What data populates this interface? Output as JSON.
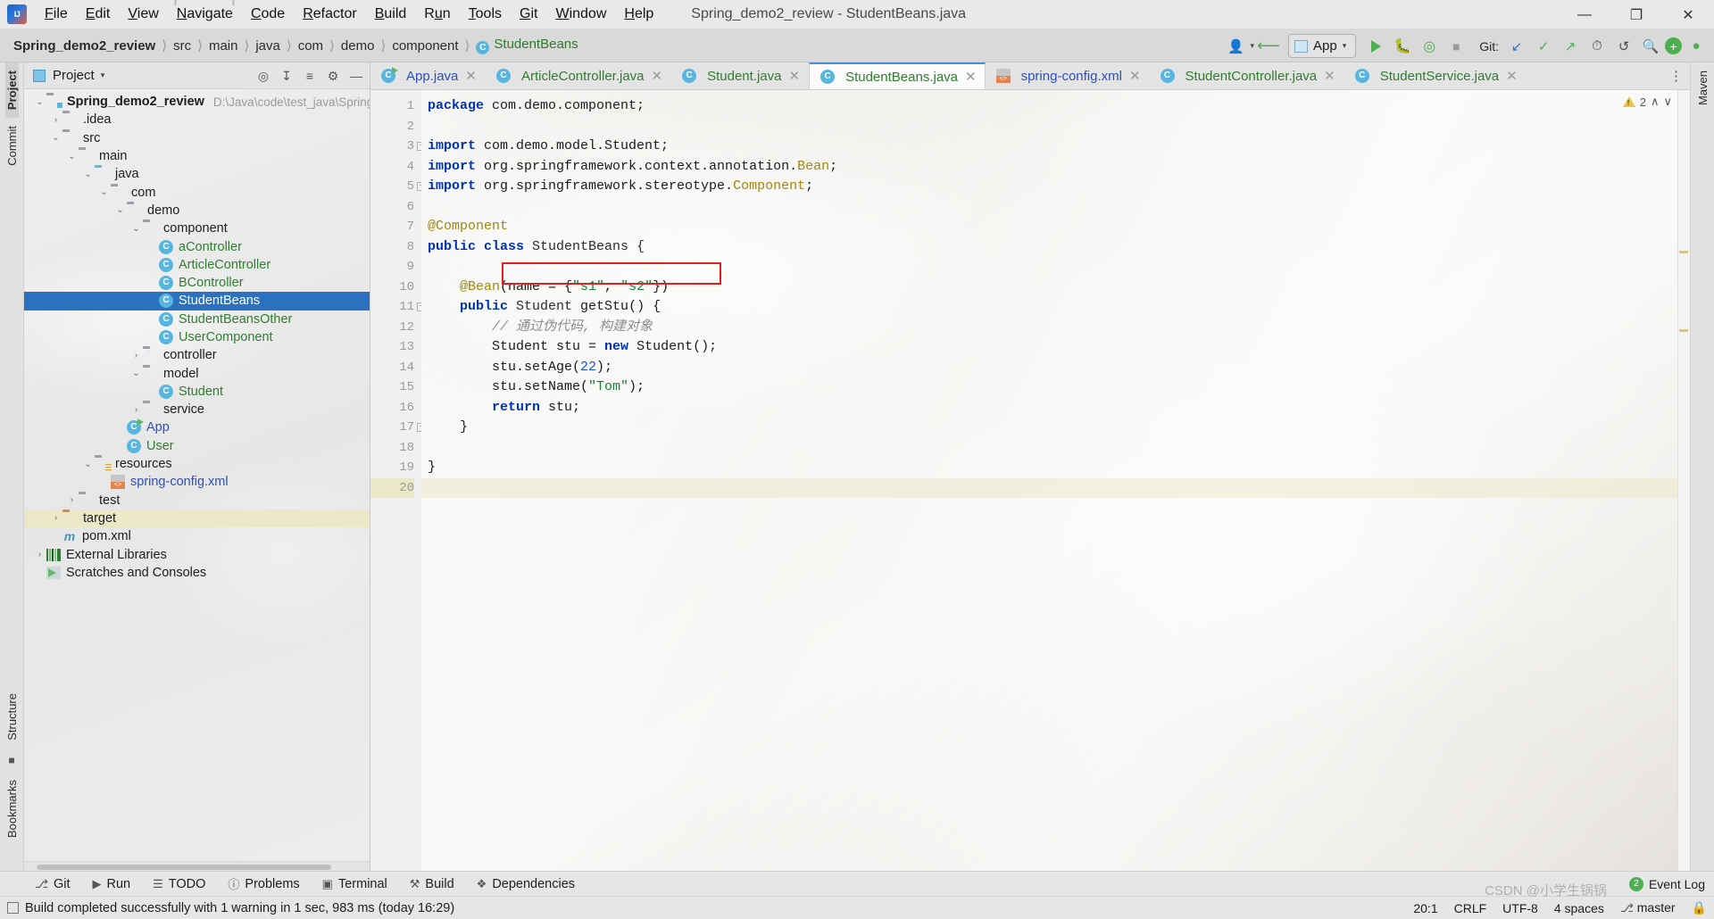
{
  "window": {
    "title": "Spring_demo2_review - StudentBeans.java",
    "minimize": "—",
    "maximize": "❐",
    "close": "✕"
  },
  "menu": {
    "items": [
      "File",
      "Edit",
      "View",
      "Navigate",
      "Code",
      "Refactor",
      "Build",
      "Run",
      "Tools",
      "Git",
      "Window",
      "Help"
    ],
    "highlighted": "Navigate"
  },
  "breadcrumb": {
    "items": [
      "Spring_demo2_review",
      "src",
      "main",
      "java",
      "com",
      "demo",
      "component",
      "StudentBeans"
    ],
    "separator": "〉",
    "class_badge": "C"
  },
  "toolbar": {
    "profile_icon": "user-icon",
    "build_icon": "hammer-icon",
    "run_config": "App",
    "run_label": "Run",
    "debug_label": "Debug",
    "coverage_label": "Run with Coverage",
    "stop_label": "Stop",
    "git_label": "Git:",
    "git_update": "↙",
    "git_commit": "✓",
    "git_push": "↗",
    "history": "◴",
    "undo": "↺",
    "search": "⚲",
    "plugin_update": "+",
    "caret": "▾"
  },
  "left_rail": {
    "project_tab": "Project",
    "commit_tab": "Commit",
    "structure_tab": "Structure",
    "bookmarks_tab": "Bookmarks"
  },
  "right_rail": {
    "maven_tab": "Maven"
  },
  "project_panel": {
    "header_title": "Project",
    "tool_icons": [
      "target-icon",
      "collapse-all-icon",
      "expand-icon",
      "settings-icon",
      "hide-icon"
    ],
    "tree": [
      {
        "depth": 0,
        "twist": "v",
        "icon": "folder-module",
        "label": "Spring_demo2_review",
        "style": "bold",
        "path": "D:\\Java\\code\\test_java\\Spring_dem"
      },
      {
        "depth": 1,
        "twist": ">",
        "icon": "folder",
        "label": ".idea",
        "style": ""
      },
      {
        "depth": 1,
        "twist": "v",
        "icon": "folder",
        "label": "src",
        "style": ""
      },
      {
        "depth": 2,
        "twist": "v",
        "icon": "folder",
        "label": "main",
        "style": ""
      },
      {
        "depth": 3,
        "twist": "v",
        "icon": "folder-source",
        "label": "java",
        "style": ""
      },
      {
        "depth": 4,
        "twist": "v",
        "icon": "folder-package",
        "label": "com",
        "style": ""
      },
      {
        "depth": 5,
        "twist": "v",
        "icon": "folder-package",
        "label": "demo",
        "style": ""
      },
      {
        "depth": 6,
        "twist": "v",
        "icon": "folder-package",
        "label": "component",
        "style": ""
      },
      {
        "depth": 7,
        "twist": "",
        "icon": "class",
        "label": "aController",
        "style": "green"
      },
      {
        "depth": 7,
        "twist": "",
        "icon": "class",
        "label": "ArticleController",
        "style": "green"
      },
      {
        "depth": 7,
        "twist": "",
        "icon": "class",
        "label": "BController",
        "style": "green"
      },
      {
        "depth": 7,
        "twist": "",
        "icon": "class",
        "label": "StudentBeans",
        "style": "selected"
      },
      {
        "depth": 7,
        "twist": "",
        "icon": "class",
        "label": "StudentBeansOther",
        "style": "green"
      },
      {
        "depth": 7,
        "twist": "",
        "icon": "class",
        "label": "UserComponent",
        "style": "green"
      },
      {
        "depth": 6,
        "twist": ">",
        "icon": "folder-package",
        "label": "controller",
        "style": ""
      },
      {
        "depth": 6,
        "twist": "v",
        "icon": "folder-package",
        "label": "model",
        "style": ""
      },
      {
        "depth": 7,
        "twist": "",
        "icon": "class",
        "label": "Student",
        "style": "green"
      },
      {
        "depth": 6,
        "twist": ">",
        "icon": "folder-package",
        "label": "service",
        "style": ""
      },
      {
        "depth": 5,
        "twist": "",
        "icon": "class-run",
        "label": "App",
        "style": "blue"
      },
      {
        "depth": 5,
        "twist": "",
        "icon": "class",
        "label": "User",
        "style": "green"
      },
      {
        "depth": 3,
        "twist": "v",
        "icon": "folder-resources",
        "label": "resources",
        "style": ""
      },
      {
        "depth": 4,
        "twist": "",
        "icon": "xml",
        "label": "spring-config.xml",
        "style": "blue"
      },
      {
        "depth": 2,
        "twist": ">",
        "icon": "folder",
        "label": "test",
        "style": ""
      },
      {
        "depth": 1,
        "twist": ">",
        "icon": "folder-excluded",
        "label": "target",
        "style": "highlight"
      },
      {
        "depth": 1,
        "twist": "",
        "icon": "maven",
        "label": "pom.xml",
        "style": ""
      },
      {
        "depth": 0,
        "twist": ">",
        "icon": "libraries",
        "label": "External Libraries",
        "style": ""
      },
      {
        "depth": 0,
        "twist": "",
        "icon": "scratches",
        "label": "Scratches and Consoles",
        "style": ""
      }
    ]
  },
  "editor": {
    "tabs": [
      {
        "label": "App.java",
        "icon": "class-run",
        "color": "blue",
        "active": false
      },
      {
        "label": "ArticleController.java",
        "icon": "class",
        "color": "green",
        "active": false
      },
      {
        "label": "Student.java",
        "icon": "class",
        "color": "green",
        "active": false
      },
      {
        "label": "StudentBeans.java",
        "icon": "class",
        "color": "green",
        "active": true
      },
      {
        "label": "spring-config.xml",
        "icon": "xml",
        "color": "blue",
        "active": false
      },
      {
        "label": "StudentController.java",
        "icon": "class",
        "color": "green",
        "active": false
      },
      {
        "label": "StudentService.java",
        "icon": "class",
        "color": "green",
        "active": false
      }
    ],
    "tab_close": "✕",
    "tab_overflow": "⋮",
    "warning_count": "2",
    "warning_up": "∧",
    "warning_down": "∨",
    "line_numbers": [
      "1",
      "2",
      "3",
      "4",
      "5",
      "6",
      "7",
      "8",
      "9",
      "10",
      "11",
      "12",
      "13",
      "14",
      "15",
      "16",
      "17",
      "18",
      "19",
      "20"
    ],
    "current_line": 20,
    "code_lines": [
      [
        {
          "t": "package ",
          "c": "k"
        },
        {
          "t": "com.demo.component;",
          "c": "nm"
        }
      ],
      [],
      [
        {
          "t": "import ",
          "c": "k"
        },
        {
          "t": "com.demo.model.Student;",
          "c": "nm"
        }
      ],
      [
        {
          "t": "import ",
          "c": "k"
        },
        {
          "t": "org.springframework.context.annotation.",
          "c": "nm"
        },
        {
          "t": "Bean",
          "c": "an"
        },
        {
          "t": ";",
          "c": "nm"
        }
      ],
      [
        {
          "t": "import ",
          "c": "k"
        },
        {
          "t": "org.springframework.stereotype.",
          "c": "nm"
        },
        {
          "t": "Component",
          "c": "an"
        },
        {
          "t": ";",
          "c": "nm"
        }
      ],
      [],
      [
        {
          "t": "@Component",
          "c": "an"
        }
      ],
      [
        {
          "t": "public ",
          "c": "k"
        },
        {
          "t": "class ",
          "c": "k"
        },
        {
          "t": "StudentBeans {",
          "c": "ty"
        }
      ],
      [],
      [
        {
          "t": "    @Bean",
          "c": "an"
        },
        {
          "t": "(name = {",
          "c": "nm"
        },
        {
          "t": "\"s1\"",
          "c": "st"
        },
        {
          "t": ", ",
          "c": "nm"
        },
        {
          "t": "\"s2\"",
          "c": "st"
        },
        {
          "t": "})",
          "c": "nm"
        }
      ],
      [
        {
          "t": "    public ",
          "c": "k"
        },
        {
          "t": "Student ",
          "c": "ty"
        },
        {
          "t": "getStu",
          "c": "nm2"
        },
        {
          "t": "() {",
          "c": "nm"
        }
      ],
      [
        {
          "t": "        // 通过伪代码, 构建对象",
          "c": "cm"
        }
      ],
      [
        {
          "t": "        Student stu = ",
          "c": "nm"
        },
        {
          "t": "new ",
          "c": "k"
        },
        {
          "t": "Student();",
          "c": "nm"
        }
      ],
      [
        {
          "t": "        stu.setAge(",
          "c": "nm"
        },
        {
          "t": "22",
          "c": "num"
        },
        {
          "t": ");",
          "c": "nm"
        }
      ],
      [
        {
          "t": "        stu.setName(",
          "c": "nm"
        },
        {
          "t": "\"Tom\"",
          "c": "st"
        },
        {
          "t": ");",
          "c": "nm"
        }
      ],
      [
        {
          "t": "        return ",
          "c": "k"
        },
        {
          "t": "stu;",
          "c": "nm"
        }
      ],
      [
        {
          "t": "    }",
          "c": "nm"
        }
      ],
      [],
      [
        {
          "t": "}",
          "c": "nm"
        }
      ],
      []
    ],
    "annotation": {
      "highlight_box_color": "#e02020",
      "arrow_color": "#e02020",
      "highlighted_text": "@Bean(name = {\"s1\", \"s2\"})"
    }
  },
  "tool_windows": {
    "items": [
      {
        "label": "Git",
        "icon": "git-icon"
      },
      {
        "label": "Run",
        "icon": "run-icon"
      },
      {
        "label": "TODO",
        "icon": "todo-icon"
      },
      {
        "label": "Problems",
        "icon": "problems-icon"
      },
      {
        "label": "Terminal",
        "icon": "terminal-icon"
      },
      {
        "label": "Build",
        "icon": "build-icon"
      },
      {
        "label": "Dependencies",
        "icon": "dependencies-icon"
      }
    ],
    "event_log": "Event Log",
    "event_log_badge": "2"
  },
  "status_bar": {
    "message": "Build completed successfully with 1 warning in 1 sec, 983 ms (today 16:29)",
    "caret_position": "20:1",
    "line_separator": "CRLF",
    "encoding": "UTF-8",
    "indent": "4 spaces",
    "branch": "master",
    "lock_icon": "🔒"
  },
  "watermark": "CSDN @小学生锅锅"
}
